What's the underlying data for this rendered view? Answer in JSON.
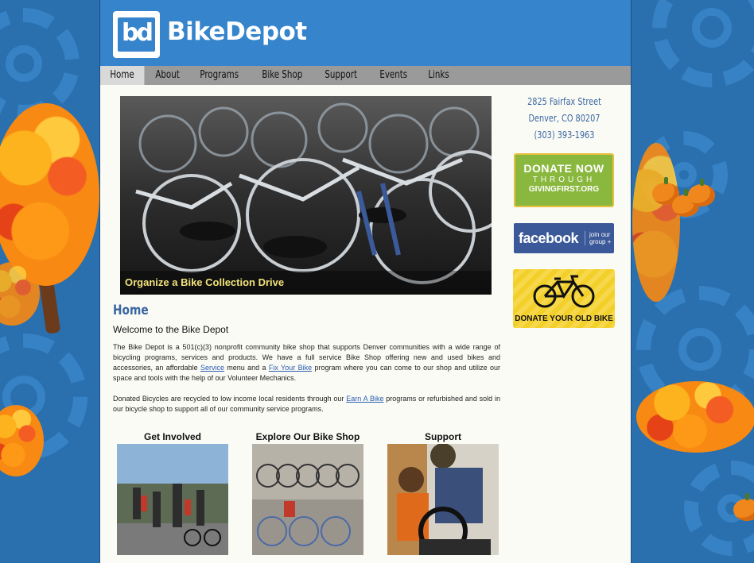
{
  "site": {
    "brand": "BikeDepot",
    "logo_text": "bd"
  },
  "nav": {
    "items": [
      {
        "label": "Home"
      },
      {
        "label": "About"
      },
      {
        "label": "Programs"
      },
      {
        "label": "Bike Shop"
      },
      {
        "label": "Support"
      },
      {
        "label": "Events"
      },
      {
        "label": "Links"
      }
    ]
  },
  "hero": {
    "caption": "Organize a Bike Collection Drive"
  },
  "sidebar": {
    "address_line1": "2825 Fairfax Street",
    "address_line2": "Denver, CO 80207",
    "phone": "(303) 393-1963",
    "donate_now": "DONATE NOW",
    "through": "THROUGH",
    "giving_first": "GIVINGFIRST.ORG",
    "facebook": "facebook",
    "join_group": "join our group +",
    "donate_bike": "DONATE YOUR OLD BIKE"
  },
  "main": {
    "heading": "Home",
    "welcome": "Welcome to the Bike Depot",
    "p1_a": "The Bike Depot is a 501(c)(3) nonprofit community bike shop that supports Denver communities with a wide range of bicycling programs, services and products. We have a full service Bike Shop offering new and used bikes and accessories, an affordable ",
    "p1_link1": "Service",
    "p1_b": " menu and a ",
    "p1_link2": "Fix Your Bike",
    "p1_c": " program where you can come to our shop and utilize our space and tools with the help of our Volunteer Mechanics.",
    "p2_a": "Donated Bicycles are recycled to low income local residents through our ",
    "p2_link": "Earn A Bike",
    "p2_b": " programs or refurbished and sold in our bicycle shop to support all of our community service programs."
  },
  "thumbs": [
    {
      "title": "Get Involved"
    },
    {
      "title": "Explore Our Bike Shop"
    },
    {
      "title": "Support"
    }
  ],
  "colors": {
    "header_blue": "#3584cc",
    "nav_gray": "#9a9a9a",
    "heading_blue": "#3a66a0",
    "donate_green": "#8ab83e",
    "facebook_blue": "#3b5998"
  }
}
